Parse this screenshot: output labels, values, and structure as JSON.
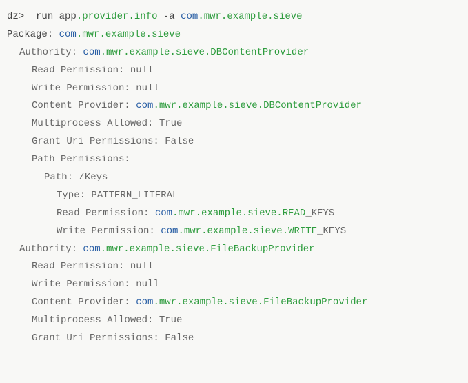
{
  "cmd": {
    "prompt": "dz> ",
    "run": " run ",
    "app": "app",
    "dot1": ".",
    "provider": "provider",
    "dot2": ".",
    "info": "info",
    "flag": " -a ",
    "pkg_com": "com",
    "pkg_mwr": ".mwr",
    "pkg_example": ".example",
    "pkg_sieve": ".sieve"
  },
  "pkg": {
    "label": "Package: ",
    "com": "com",
    "mwr": ".mwr",
    "example": ".example",
    "sieve": ".sieve"
  },
  "auth1": {
    "label": "Authority: ",
    "com": "com",
    "mwr": ".mwr",
    "example": ".example",
    "sieve": ".sieve",
    "db": ".DBContentProvider",
    "read_label": "Read Permission: ",
    "read_val": "null",
    "write_label": "Write Permission: ",
    "write_val": "null",
    "cp_label": "Content Provider: ",
    "cp_com": "com",
    "cp_mwr": ".mwr",
    "cp_example": ".example",
    "cp_sieve": ".sieve",
    "cp_db": ".DBContentProvider",
    "multi_label": "Multiprocess Allowed: ",
    "multi_val": "True",
    "grant_label": "Grant Uri Permissions: ",
    "grant_val": "False",
    "pathperm_label": "Path Permissions:",
    "path_label": "Path: ",
    "path_val": "/Keys",
    "type_label": "Type: ",
    "type_val": "PATTERN_LITERAL",
    "pread_label": "Read Permission: ",
    "pread_com": "com",
    "pread_mwr": ".mwr",
    "pread_example": ".example",
    "pread_sieve": ".sieve",
    "pread_read": ".READ",
    "pread_keys": "_KEYS",
    "pwrite_label": "Write Permission: ",
    "pwrite_com": "com",
    "pwrite_mwr": ".mwr",
    "pwrite_example": ".example",
    "pwrite_sieve": ".sieve",
    "pwrite_write": ".WRITE",
    "pwrite_keys": "_KEYS"
  },
  "auth2": {
    "label": "Authority: ",
    "com": "com",
    "mwr": ".mwr",
    "example": ".example",
    "sieve": ".sieve",
    "fb": ".FileBackupProvider",
    "read_label": "Read Permission: ",
    "read_val": "null",
    "write_label": "Write Permission: ",
    "write_val": "null",
    "cp_label": "Content Provider: ",
    "cp_com": "com",
    "cp_mwr": ".mwr",
    "cp_example": ".example",
    "cp_sieve": ".sieve",
    "cp_fb": ".FileBackupProvider",
    "multi_label": "Multiprocess Allowed: ",
    "multi_val": "True",
    "grant_label": "Grant Uri Permissions: ",
    "grant_val": "False"
  }
}
